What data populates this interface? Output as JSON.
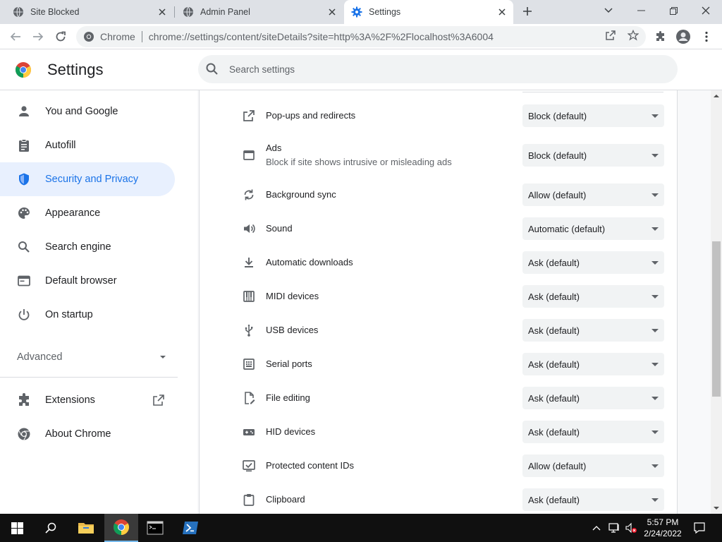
{
  "tabs": [
    {
      "title": "Site Blocked",
      "icon": "globe-icon",
      "active": false
    },
    {
      "title": "Admin Panel",
      "icon": "globe-icon",
      "active": false
    },
    {
      "title": "Settings",
      "icon": "gear-icon",
      "active": true
    }
  ],
  "toolbar": {
    "site_chip": "Chrome",
    "url": "chrome://settings/content/siteDetails?site=http%3A%2F%2Flocalhost%3A6004"
  },
  "header": {
    "title": "Settings",
    "search_placeholder": "Search settings"
  },
  "sidebar": {
    "items": [
      {
        "label": "You and Google",
        "icon": "person-icon"
      },
      {
        "label": "Autofill",
        "icon": "clipboard-icon"
      },
      {
        "label": "Security and Privacy",
        "icon": "shield-icon",
        "active": true
      },
      {
        "label": "Appearance",
        "icon": "palette-icon"
      },
      {
        "label": "Search engine",
        "icon": "search-icon"
      },
      {
        "label": "Default browser",
        "icon": "browser-icon"
      },
      {
        "label": "On startup",
        "icon": "power-icon"
      }
    ],
    "advanced_label": "Advanced",
    "extensions_label": "Extensions",
    "about_label": "About Chrome"
  },
  "permissions": [
    {
      "label": "Pop-ups and redirects",
      "value": "Block (default)",
      "icon": "open-in-new-icon"
    },
    {
      "label": "Ads",
      "sublabel": "Block if site shows intrusive or misleading ads",
      "value": "Block (default)",
      "icon": "ads-window-icon"
    },
    {
      "label": "Background sync",
      "value": "Allow (default)",
      "icon": "sync-icon"
    },
    {
      "label": "Sound",
      "value": "Automatic (default)",
      "icon": "volume-icon"
    },
    {
      "label": "Automatic downloads",
      "value": "Ask (default)",
      "icon": "download-icon"
    },
    {
      "label": "MIDI devices",
      "value": "Ask (default)",
      "icon": "piano-icon"
    },
    {
      "label": "USB devices",
      "value": "Ask (default)",
      "icon": "usb-icon"
    },
    {
      "label": "Serial ports",
      "value": "Ask (default)",
      "icon": "serial-port-icon"
    },
    {
      "label": "File editing",
      "value": "Ask (default)",
      "icon": "file-edit-icon"
    },
    {
      "label": "HID devices",
      "value": "Ask (default)",
      "icon": "gamepad-icon"
    },
    {
      "label": "Protected content IDs",
      "value": "Allow (default)",
      "icon": "protected-content-icon"
    },
    {
      "label": "Clipboard",
      "value": "Ask (default)",
      "icon": "clipboard-icon"
    }
  ],
  "taskbar": {
    "time": "5:57 PM",
    "date": "2/24/2022"
  },
  "colors": {
    "accent": "#1a73e8",
    "active_nav_bg": "#e8f0fe",
    "tabstrip_bg": "#dee1e6",
    "taskbar_bg": "#101010"
  }
}
